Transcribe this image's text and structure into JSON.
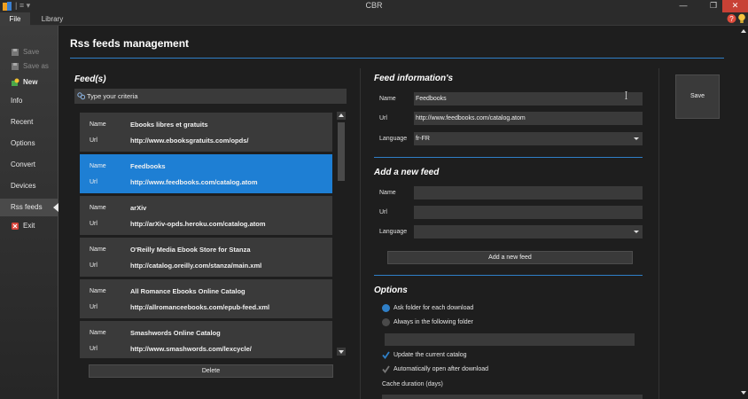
{
  "window": {
    "title": "CBR",
    "quick_access": "| ≡ ▾",
    "minimize": "—",
    "maximize": "❐",
    "close": "✕"
  },
  "tabs": {
    "file": "File",
    "library": "Library"
  },
  "sidebar": {
    "items": [
      {
        "label": "Save",
        "icon": "save-icon",
        "disabled": true
      },
      {
        "label": "Save as",
        "icon": "save-as-icon",
        "disabled": true
      },
      {
        "label": "New",
        "icon": "new-icon",
        "disabled": false
      },
      {
        "label": "Info",
        "disabled": false
      },
      {
        "label": "Recent",
        "disabled": false
      },
      {
        "label": "Options",
        "disabled": false
      },
      {
        "label": "Convert",
        "disabled": false
      },
      {
        "label": "Devices",
        "disabled": false
      },
      {
        "label": "Rss feeds",
        "disabled": false,
        "active": true
      },
      {
        "label": "Exit",
        "icon": "exit-icon",
        "disabled": false
      }
    ]
  },
  "page": {
    "title": "Rss feeds management"
  },
  "feeds_panel": {
    "title": "Feed(s)",
    "search_placeholder": "Type your criteria",
    "name_key": "Name",
    "url_key": "Url",
    "feeds": [
      {
        "name": "Ebooks libres et gratuits",
        "url": "http://www.ebooksgratuits.com/opds/"
      },
      {
        "name": "Feedbooks",
        "url": "http://www.feedbooks.com/catalog.atom",
        "selected": true
      },
      {
        "name": "arXiv",
        "url": "http://arXiv-opds.heroku.com/catalog.atom"
      },
      {
        "name": "O'Reilly Media Ebook Store for Stanza",
        "url": "http://catalog.oreilly.com/stanza/main.xml"
      },
      {
        "name": "All Romance Ebooks Online Catalog",
        "url": "http://allromanceebooks.com/epub-feed.xml"
      },
      {
        "name": "Smashwords Online Catalog",
        "url": "http://www.smashwords.com/lexcycle/"
      }
    ],
    "delete_label": "Delete"
  },
  "feed_info": {
    "title": "Feed information's",
    "name_label": "Name",
    "name_value": "Feedbooks",
    "url_label": "Url",
    "url_value": "http://www.feedbooks.com/catalog.atom",
    "language_label": "Language",
    "language_value": "fr-FR"
  },
  "add_feed": {
    "title": "Add a new feed",
    "name_label": "Name",
    "url_label": "Url",
    "language_label": "Language",
    "button_label": "Add a new feed"
  },
  "options": {
    "title": "Options",
    "ask_folder": "Ask folder for each download",
    "always_folder": "Always in the following folder",
    "update_catalog": "Update the current catalog",
    "auto_open": "Automatically open after download",
    "cache_label": "Cache duration (days)"
  },
  "save_label": "Save",
  "colors": {
    "accent": "#2f7fc7",
    "selected": "#1e7fd4",
    "close": "#c84135"
  }
}
